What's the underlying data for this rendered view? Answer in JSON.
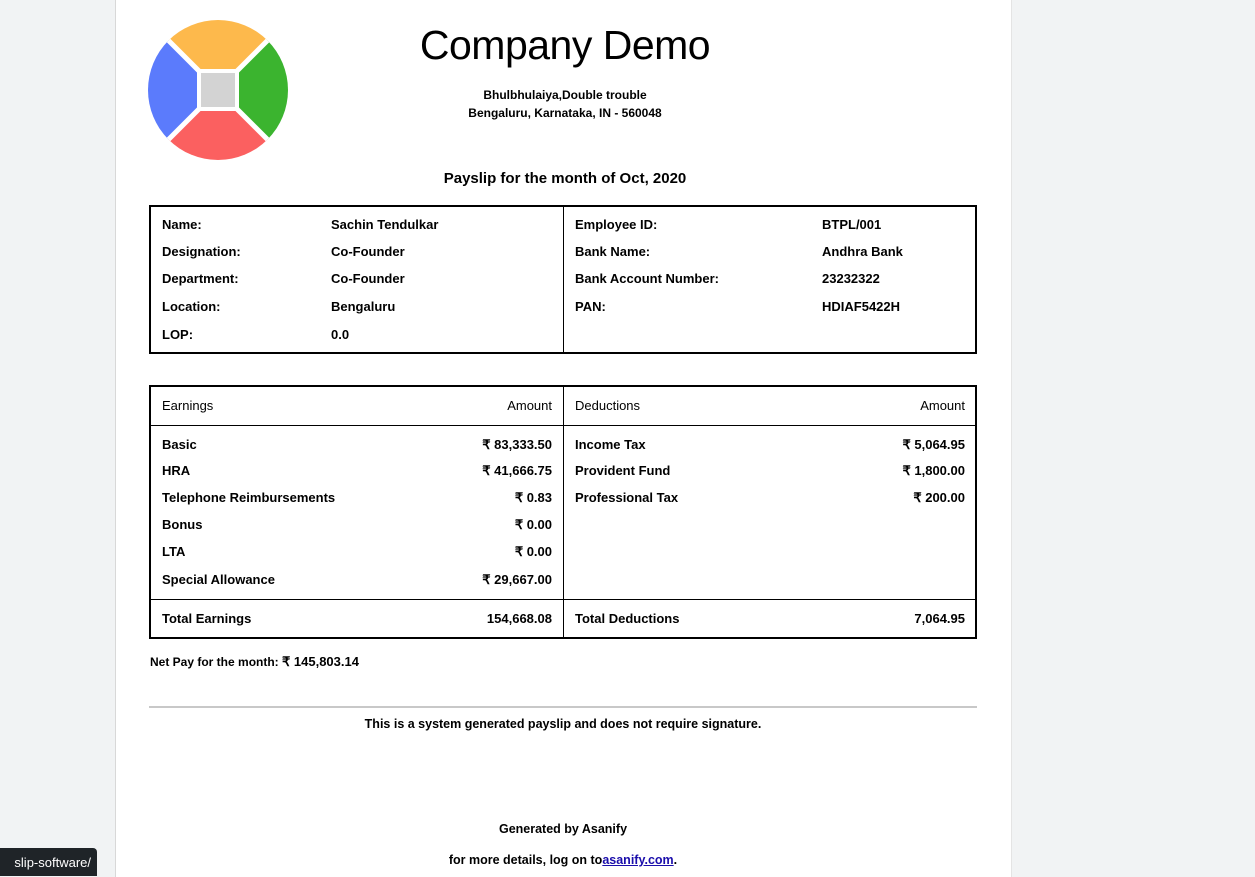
{
  "company": {
    "name": "Company Demo",
    "address_line1": "Bhulbhulaiya,Double trouble",
    "address_line2": "Bengaluru, Karnataka, IN - 560048"
  },
  "payslip_title": "Payslip for the month of Oct, 2020",
  "employee": {
    "left": [
      {
        "label": "Name:",
        "value": "Sachin Tendulkar"
      },
      {
        "label": "Designation:",
        "value": "Co-Founder"
      },
      {
        "label": "Department:",
        "value": "Co-Founder"
      },
      {
        "label": "Location:",
        "value": "Bengaluru"
      },
      {
        "label": "LOP:",
        "value": "0.0"
      }
    ],
    "right": [
      {
        "label": "Employee ID:",
        "value": "BTPL/001"
      },
      {
        "label": "Bank Name:",
        "value": "Andhra Bank"
      },
      {
        "label": "Bank Account Number:",
        "value": "23232322"
      },
      {
        "label": "PAN:",
        "value": "HDIAF5422H"
      }
    ]
  },
  "earnings": {
    "header": "Earnings",
    "amount_header": "Amount",
    "rows": [
      {
        "label": "Basic",
        "amount": "₹ 83,333.50"
      },
      {
        "label": "HRA",
        "amount": "₹ 41,666.75"
      },
      {
        "label": "Telephone Reimbursements",
        "amount": "₹ 0.83"
      },
      {
        "label": "Bonus",
        "amount": "₹ 0.00"
      },
      {
        "label": "LTA",
        "amount": "₹ 0.00"
      },
      {
        "label": "Special Allowance",
        "amount": "₹ 29,667.00"
      }
    ],
    "total_label": "Total Earnings",
    "total_amount": "154,668.08"
  },
  "deductions": {
    "header": "Deductions",
    "amount_header": "Amount",
    "rows": [
      {
        "label": "Income Tax",
        "amount": "₹ 5,064.95"
      },
      {
        "label": "Provident Fund",
        "amount": "₹ 1,800.00"
      },
      {
        "label": "Professional Tax",
        "amount": "₹ 200.00"
      }
    ],
    "total_label": "Total Deductions",
    "total_amount": "7,064.95"
  },
  "net_pay": {
    "label": "Net Pay for the month:",
    "amount": "₹ 145,803.14"
  },
  "footer": {
    "system_note": "This is a system generated payslip and does not require signature.",
    "generated_by": "Generated by Asanify",
    "details_prefix": "for more details, log on to",
    "details_link": "asanify.com",
    "details_suffix": "."
  },
  "status_bar": {
    "url_fragment": "slip-software/"
  },
  "colors": {
    "logo_top": "#FDB94C",
    "logo_left": "#5B7BFC",
    "logo_right": "#3BB42F",
    "logo_bottom": "#FB6060",
    "logo_center": "#D3D3D3"
  }
}
